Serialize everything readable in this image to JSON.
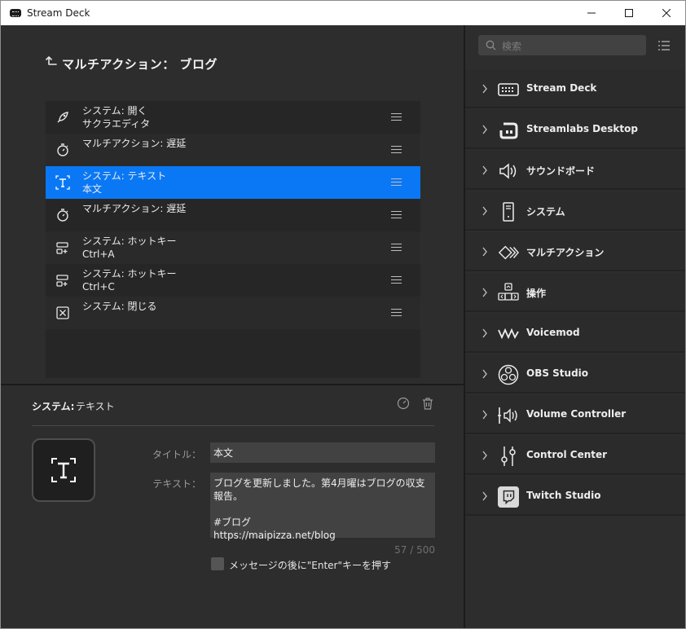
{
  "window": {
    "title": "Stream Deck"
  },
  "multi_action": {
    "title": "マルチアクション： ブログ"
  },
  "actions": [
    {
      "line1": "システム: 開く",
      "line2": "サクラエディタ",
      "icon": "rocket-icon"
    },
    {
      "line1": "マルチアクション: 遅延",
      "line2": "",
      "icon": "stopwatch-icon"
    },
    {
      "line1": "システム: テキスト",
      "line2": "本文",
      "icon": "text-icon",
      "selected": true
    },
    {
      "line1": "マルチアクション: 遅延",
      "line2": "",
      "icon": "stopwatch-icon"
    },
    {
      "line1": "システム: ホットキー",
      "line2": "Ctrl+A",
      "icon": "hotkey-icon"
    },
    {
      "line1": "システム: ホットキー",
      "line2": "Ctrl+C",
      "icon": "hotkey-icon"
    },
    {
      "line1": "システム: 閉じる",
      "line2": "",
      "icon": "close-box-icon"
    }
  ],
  "inspector": {
    "category": "システム:",
    "action_name": "テキスト",
    "title_label": "タイトル：",
    "title_value": "本文",
    "text_label": "テキスト：",
    "text_value": "ブログを更新しました。第4月曜はブログの収支報告。\n\n#ブログ\nhttps://maipizza.net/blog",
    "char_count": "57 / 500",
    "enter_checkbox_label": "メッセージの後に\"Enter\"キーを押す",
    "enter_checked": false
  },
  "search": {
    "placeholder": "検索"
  },
  "categories": [
    {
      "label": "Stream Deck",
      "icon": "stream-deck-icon"
    },
    {
      "label": "Streamlabs Desktop",
      "icon": "streamlabs-icon"
    },
    {
      "label": "サウンドボード",
      "icon": "speaker-icon"
    },
    {
      "label": "システム",
      "icon": "system-tower-icon"
    },
    {
      "label": "マルチアクション",
      "icon": "multi-action-icon"
    },
    {
      "label": "操作",
      "icon": "navigation-keys-icon"
    },
    {
      "label": "Voicemod",
      "icon": "voicemod-icon"
    },
    {
      "label": "OBS Studio",
      "icon": "obs-icon"
    },
    {
      "label": "Volume Controller",
      "icon": "volume-controller-icon"
    },
    {
      "label": "Control Center",
      "icon": "control-center-icon"
    },
    {
      "label": "Twitch Studio",
      "icon": "twitch-icon"
    }
  ],
  "colors": {
    "selection": "#0a78f5",
    "panel": "#2d2d2d",
    "list_bg": "#262626"
  }
}
